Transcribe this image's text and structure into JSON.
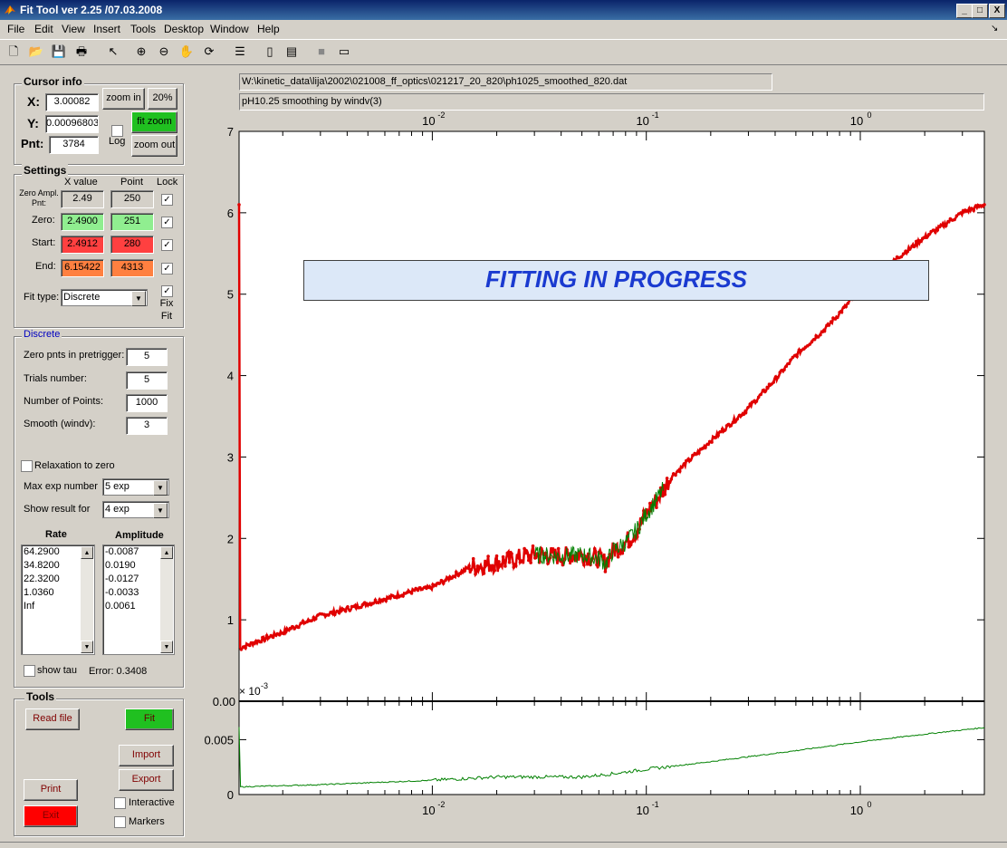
{
  "window": {
    "title": "Fit Tool ver 2.25 /07.03.2008",
    "min": "_",
    "max": "□",
    "close": "X"
  },
  "menu": [
    "File",
    "Edit",
    "View",
    "Insert",
    "Tools",
    "Desktop",
    "Window",
    "Help"
  ],
  "toolbar_icons": [
    "new-file",
    "open",
    "save",
    "print",
    "pointer",
    "zoom-in",
    "zoom-out",
    "pan",
    "rotate",
    "insert-legend",
    "colorbar",
    "legend",
    "data-cursor",
    "plot-tools"
  ],
  "cursor_info": {
    "title": "Cursor info",
    "x_label": "X:",
    "x_value": "3.00082",
    "y_label": "Y:",
    "y_value": "0.00096803",
    "pnt_label": "Pnt:",
    "pnt_value": "3784",
    "zoom_in": "zoom in",
    "pct": "20%",
    "fit_zoom": "fit zoom",
    "zoom_out": "zoom out",
    "log": "Log"
  },
  "settings": {
    "title": "Settings",
    "col_x": "X value",
    "col_point": "Point",
    "col_lock": "Lock",
    "rows": [
      {
        "label": "Zero Ampl. Pnt:",
        "x": "2.49",
        "point": "250",
        "color": "#d4d0c8"
      },
      {
        "label": "Zero:",
        "x": "2.4900",
        "point": "251",
        "color": "#90ee90"
      },
      {
        "label": "Start:",
        "x": "2.4912",
        "point": "280",
        "color": "#ff4040"
      },
      {
        "label": "End:",
        "x": "6.15422",
        "point": "4313",
        "color": "#ff8040"
      }
    ],
    "fit_type_label": "Fit type:",
    "fit_type": "Discrete",
    "fix_fit": "Fix Fit"
  },
  "discrete": {
    "title": "Discrete",
    "zero_pnts_label": "Zero pnts in pretrigger:",
    "zero_pnts": "5",
    "trials_label": "Trials number:",
    "trials": "5",
    "npoints_label": "Number of Points:",
    "npoints": "1000",
    "smooth_label": "Smooth (windv):",
    "smooth": "3",
    "relax_label": "Relaxation to zero",
    "maxexp_label": "Max exp number",
    "maxexp": "5 exp",
    "showres_label": "Show result for",
    "showres": "4 exp",
    "rate_header": "Rate",
    "amp_header": "Amplitude",
    "rates": [
      "64.2900",
      "34.8200",
      "22.3200",
      "1.0360",
      "",
      "Inf"
    ],
    "amps": [
      "-0.0087",
      "0.0190",
      "-0.0127",
      "-0.0033",
      "0.0061"
    ],
    "show_tau": "show tau",
    "error": "Error: 0.3408"
  },
  "tools": {
    "title": "Tools",
    "read_file": "Read file",
    "fit": "Fit",
    "import": "Import",
    "export": "Export",
    "print": "Print",
    "exit": "Exit",
    "interactive": "Interactive",
    "markers": "Markers"
  },
  "file_path": "W:\\kinetic_data\\lija\\2002\\021008_ff_optics\\021217_20_820\\ph1025_smoothed_820.dat",
  "description": "pH10.25 smoothing by windv(3)",
  "banner": "FITTING IN PROGRESS",
  "colors": {
    "data": "#e00000",
    "fit": "#008000",
    "banner_text": "#1a3ad0",
    "banner_bg": "#dce8f8",
    "fit_button": "#20c020",
    "exit_button": "#ff0000"
  },
  "chart_data": [
    {
      "type": "scatter",
      "x_scale": "log",
      "xlim": [
        0.00125,
        3.8
      ],
      "ylim": [
        0,
        7
      ],
      "xticks": [
        "10",
        "10",
        "10"
      ],
      "xtick_exps": [
        "-2",
        "-1",
        "0"
      ],
      "yticks": [
        "1",
        "2",
        "3",
        "4",
        "5",
        "6",
        "7"
      ],
      "series": [
        {
          "x": [
            0.00125,
            0.002,
            0.003,
            0.005,
            0.008,
            0.01,
            0.015,
            0.02,
            0.03,
            0.04,
            0.05,
            0.06,
            0.065,
            0.07,
            0.08,
            0.09,
            0.1,
            0.11,
            0.12,
            0.13,
            0.15,
            0.2,
            0.3,
            0.4,
            0.5,
            0.7,
            1.0,
            1.5,
            2.0,
            3.0,
            3.8
          ],
          "y": [
            0.65,
            0.85,
            1.05,
            1.2,
            1.35,
            1.4,
            1.65,
            1.7,
            1.8,
            1.78,
            1.8,
            1.75,
            1.7,
            1.85,
            1.95,
            2.1,
            2.3,
            2.45,
            2.6,
            2.75,
            2.9,
            3.2,
            3.6,
            3.95,
            4.25,
            4.6,
            5.05,
            5.45,
            5.7,
            6.0,
            6.1
          ]
        },
        {
          "x": [
            0.03,
            0.04,
            0.05,
            0.06,
            0.065,
            0.07,
            0.08,
            0.09,
            0.1,
            0.11,
            0.12
          ],
          "y": [
            1.8,
            1.78,
            1.8,
            1.75,
            1.7,
            1.85,
            1.95,
            2.1,
            2.3,
            2.45,
            2.6
          ]
        }
      ]
    },
    {
      "type": "line",
      "x_scale": "log",
      "xlim": [
        0.00125,
        3.8
      ],
      "ylim": [
        0,
        0.0085
      ],
      "exponent_label": "× 10",
      "exponent_power": "-3",
      "yticks": [
        "0",
        "0.005",
        "0.00"
      ],
      "series": [
        {
          "x": [
            0.00125,
            0.003,
            0.01,
            0.02,
            0.05,
            0.07,
            0.1,
            0.2,
            0.5,
            1.0,
            2.0,
            3.8
          ],
          "y": [
            0.0007,
            0.0009,
            0.0013,
            0.0016,
            0.0016,
            0.0019,
            0.0023,
            0.003,
            0.004,
            0.0048,
            0.0055,
            0.0061
          ]
        }
      ]
    }
  ]
}
